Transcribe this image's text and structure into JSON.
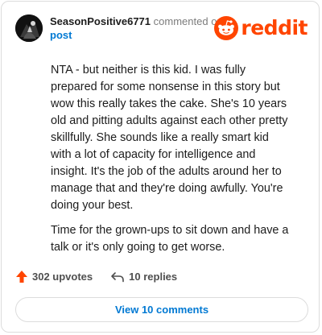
{
  "comment": {
    "username": "SeasonPositive6771",
    "action_text": "commented on",
    "target_link": "post",
    "paragraphs": [
      "NTA - but neither is this kid. I was fully prepared for some nonsense in this story but wow this really takes the cake. She's 10 years old and pitting adults against each other pretty skillfully. She sounds like a really smart kid with a lot of capacity for intelligence and insight. It's the job of the adults around her to manage that and they're doing awfully. You're doing your best.",
      "Time for the grown-ups to sit down and have a talk or it's only going to get worse."
    ]
  },
  "logo": {
    "wordmark": "reddit",
    "brand_color": "#ff4500"
  },
  "actions": {
    "upvotes_label": "302 upvotes",
    "replies_label": "10 replies",
    "upvote_color": "#ff4500"
  },
  "footer": {
    "view_comments_label": "View 10 comments",
    "link_color": "#0079d3"
  },
  "icons": {
    "avatar": "avatar-icon",
    "logo": "reddit-snoo-icon",
    "upvote": "upvote-arrow-icon",
    "reply": "reply-arrow-icon"
  }
}
